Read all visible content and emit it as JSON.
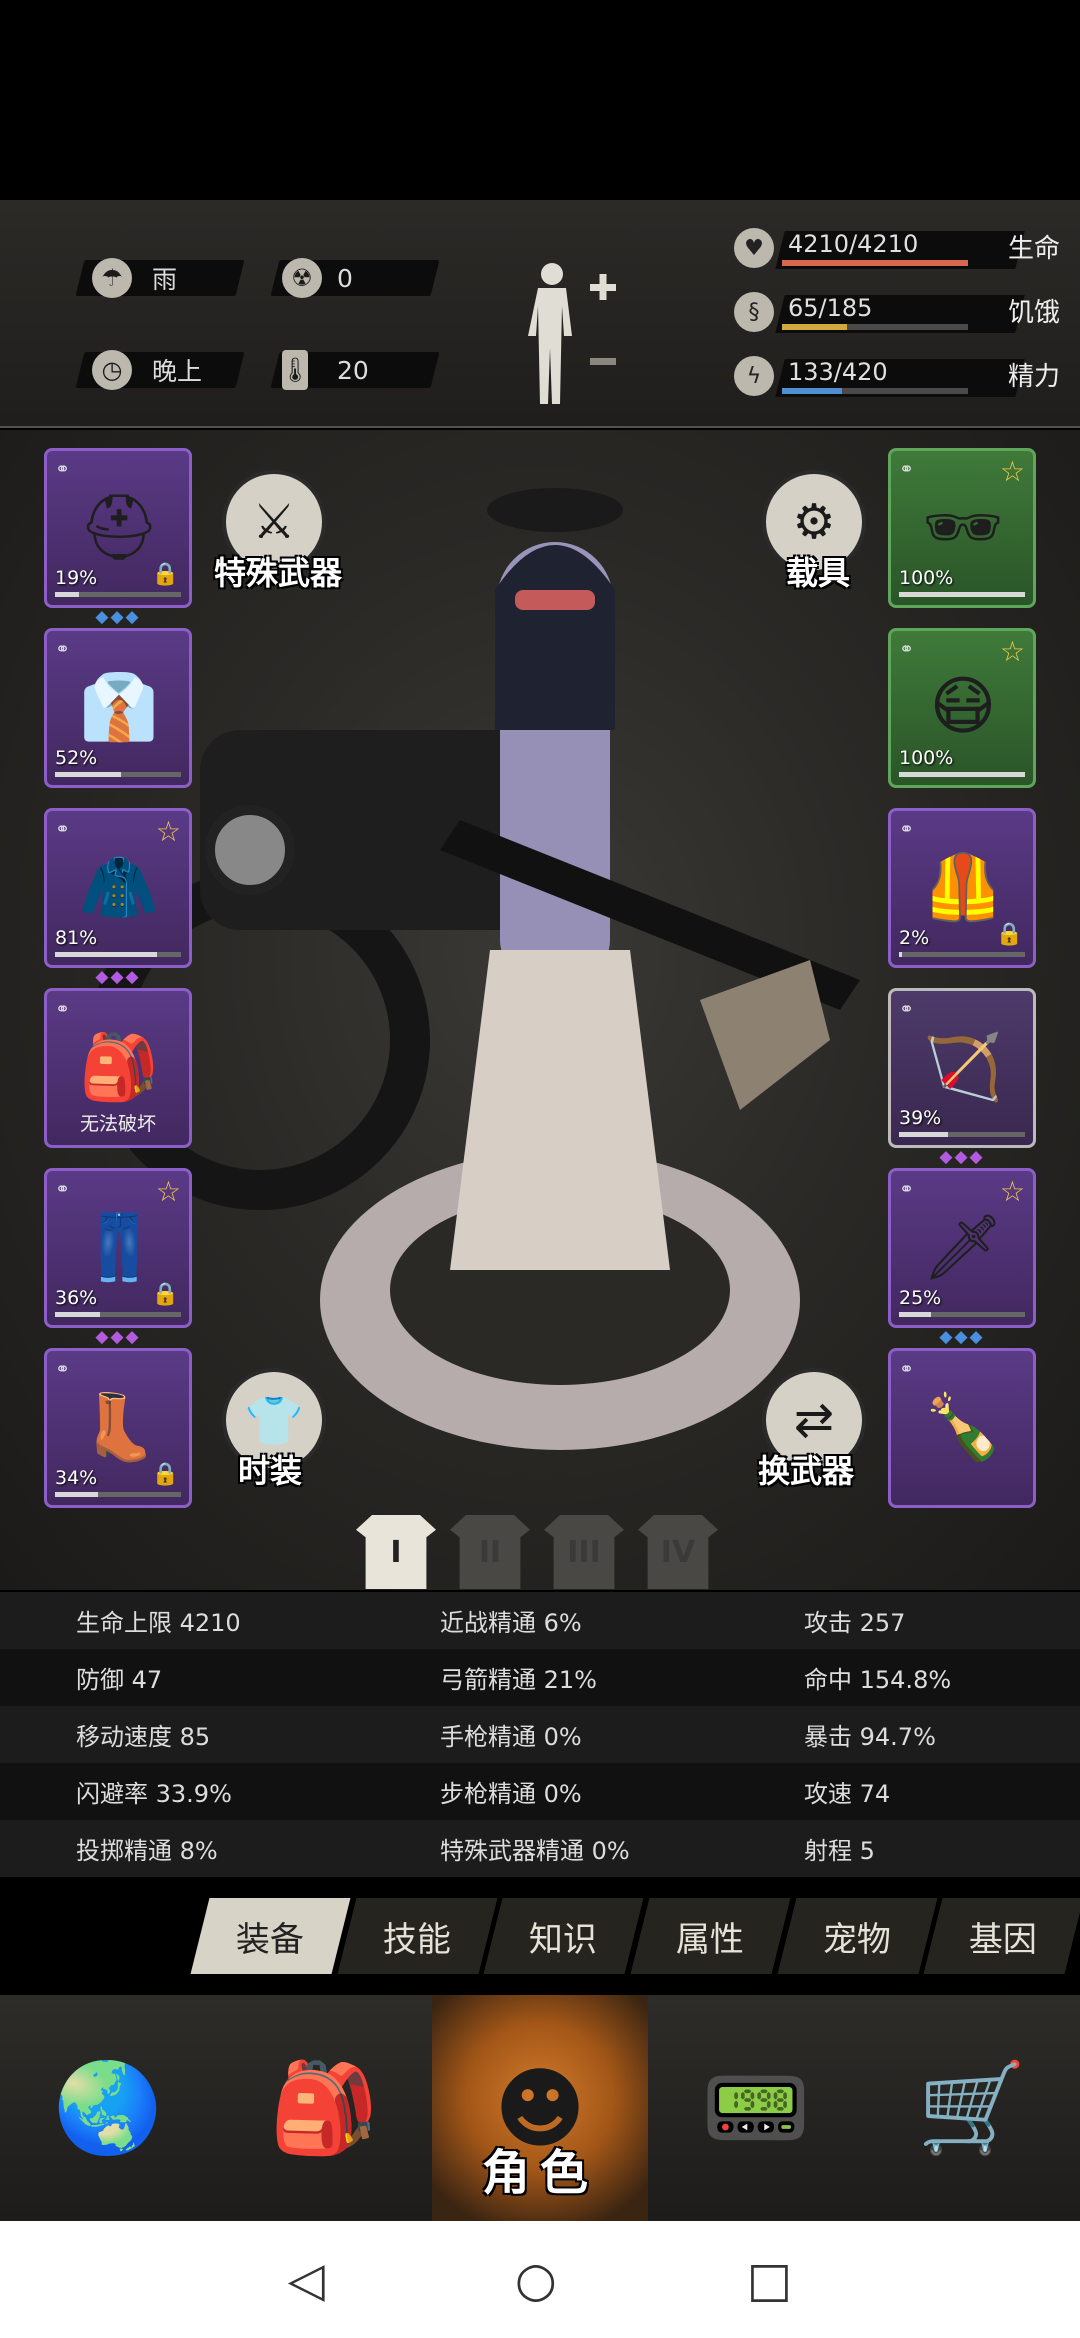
{
  "weather": {
    "label": "雨",
    "icon": "cloud-rain-icon"
  },
  "radiation": {
    "value": "0",
    "icon": "radiation-icon"
  },
  "time": {
    "label": "晚上",
    "icon": "clock-icon"
  },
  "temperature": {
    "value": "20",
    "icon": "thermometer-icon"
  },
  "vitals": [
    {
      "value": "4210/4210",
      "label": "生命",
      "fill": 1.0,
      "color": "#d9664e",
      "icon": "heart-icon"
    },
    {
      "value": "65/185",
      "label": "饥饿",
      "fill": 0.35,
      "color": "#d2a93c",
      "icon": "stomach-icon"
    },
    {
      "value": "133/420",
      "label": "精力",
      "fill": 0.32,
      "color": "#4f8fd0",
      "icon": "energy-icon"
    }
  ],
  "actions": {
    "special_weapon": "特殊武器",
    "vehicle": "载具",
    "costume": "时装",
    "swap_weapon": "换武器"
  },
  "left_slots": [
    {
      "name": "helmet",
      "pct": "19%",
      "durability": 0.19,
      "locked": true,
      "star": false,
      "gems": "◆◆◆",
      "gem_color": "#4a8fe0"
    },
    {
      "name": "shirt",
      "pct": "52%",
      "durability": 0.52,
      "locked": false,
      "star": false,
      "gems": "",
      "gem_color": "#4a8fe0"
    },
    {
      "name": "jacket",
      "pct": "81%",
      "durability": 0.81,
      "locked": false,
      "star": true,
      "gems": "◆◆◆",
      "gem_color": "#b25be0"
    },
    {
      "name": "backpack",
      "note": "无法破坏",
      "locked": false,
      "star": false,
      "gems": ""
    },
    {
      "name": "pants",
      "pct": "36%",
      "durability": 0.36,
      "locked": true,
      "star": true,
      "gems": "◆◆◆",
      "gem_color": "#b25be0"
    },
    {
      "name": "boots",
      "pct": "34%",
      "durability": 0.34,
      "locked": true,
      "star": false,
      "gems": ""
    }
  ],
  "right_slots": [
    {
      "name": "goggles",
      "pct": "100%",
      "durability": 1.0,
      "locked": false,
      "star": true,
      "gems": "",
      "tier": "green"
    },
    {
      "name": "mask",
      "pct": "100%",
      "durability": 1.0,
      "locked": false,
      "star": true,
      "gems": "",
      "tier": "green"
    },
    {
      "name": "vest",
      "pct": "2%",
      "durability": 0.02,
      "locked": true,
      "star": false,
      "gems": "",
      "tier": "purple"
    },
    {
      "name": "crossbow",
      "pct": "39%",
      "durability": 0.39,
      "locked": false,
      "star": false,
      "gems": "◆◆◆",
      "gem_color": "#b25be0",
      "tier": "gray"
    },
    {
      "name": "spear",
      "pct": "25%",
      "durability": 0.25,
      "locked": false,
      "star": true,
      "gems": "◆◆◆",
      "gem_color": "#4a8fe0",
      "tier": "purple"
    },
    {
      "name": "molotov",
      "locked": false,
      "star": false,
      "gems": "",
      "tier": "purple"
    }
  ],
  "outfit_tabs": [
    "I",
    "II",
    "III",
    "IV"
  ],
  "stats": [
    [
      "生命上限 4210",
      "近战精通 6%",
      "攻击 257"
    ],
    [
      "防御 47",
      "弓箭精通 21%",
      "命中 154.8%"
    ],
    [
      "移动速度 85",
      "手枪精通 0%",
      "暴击 94.7%"
    ],
    [
      "闪避率 33.9%",
      "步枪精通 0%",
      "攻速 74"
    ],
    [
      "投掷精通 8%",
      "特殊武器精通 0%",
      "射程 5"
    ]
  ],
  "tabs": [
    "装备",
    "技能",
    "知识",
    "属性",
    "宠物",
    "基因"
  ],
  "nav": {
    "character": "角色"
  }
}
